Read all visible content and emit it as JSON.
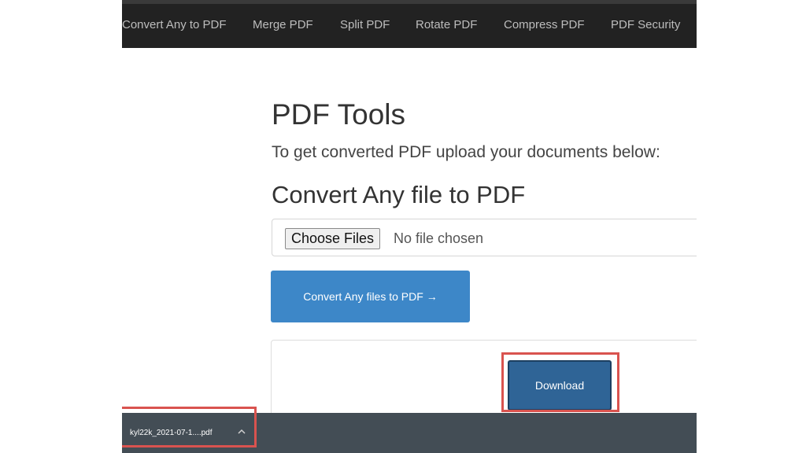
{
  "nav": {
    "items": [
      {
        "label": "Convert Any to PDF"
      },
      {
        "label": "Merge PDF"
      },
      {
        "label": "Split PDF"
      },
      {
        "label": "Rotate PDF"
      },
      {
        "label": "Compress PDF"
      },
      {
        "label": "PDF Security"
      }
    ]
  },
  "main": {
    "title": "PDF Tools",
    "subtitle": "To get converted PDF upload your documents below:",
    "section_heading": "Convert Any file to PDF",
    "file_input": {
      "button_label": "Choose Files",
      "status_text": "No file chosen"
    },
    "convert_button_label": "Convert Any files to PDF →",
    "download_button_label": "Download"
  },
  "download_bar": {
    "filename": "kyl22k_2021-07-1....pdf",
    "chevron_icon": "chevron-up-icon"
  },
  "colors": {
    "navbar": "#222222",
    "primary_button": "#3d87c8",
    "download_button": "#2f6496",
    "highlight": "#d9534f",
    "download_bar": "#434d55"
  }
}
